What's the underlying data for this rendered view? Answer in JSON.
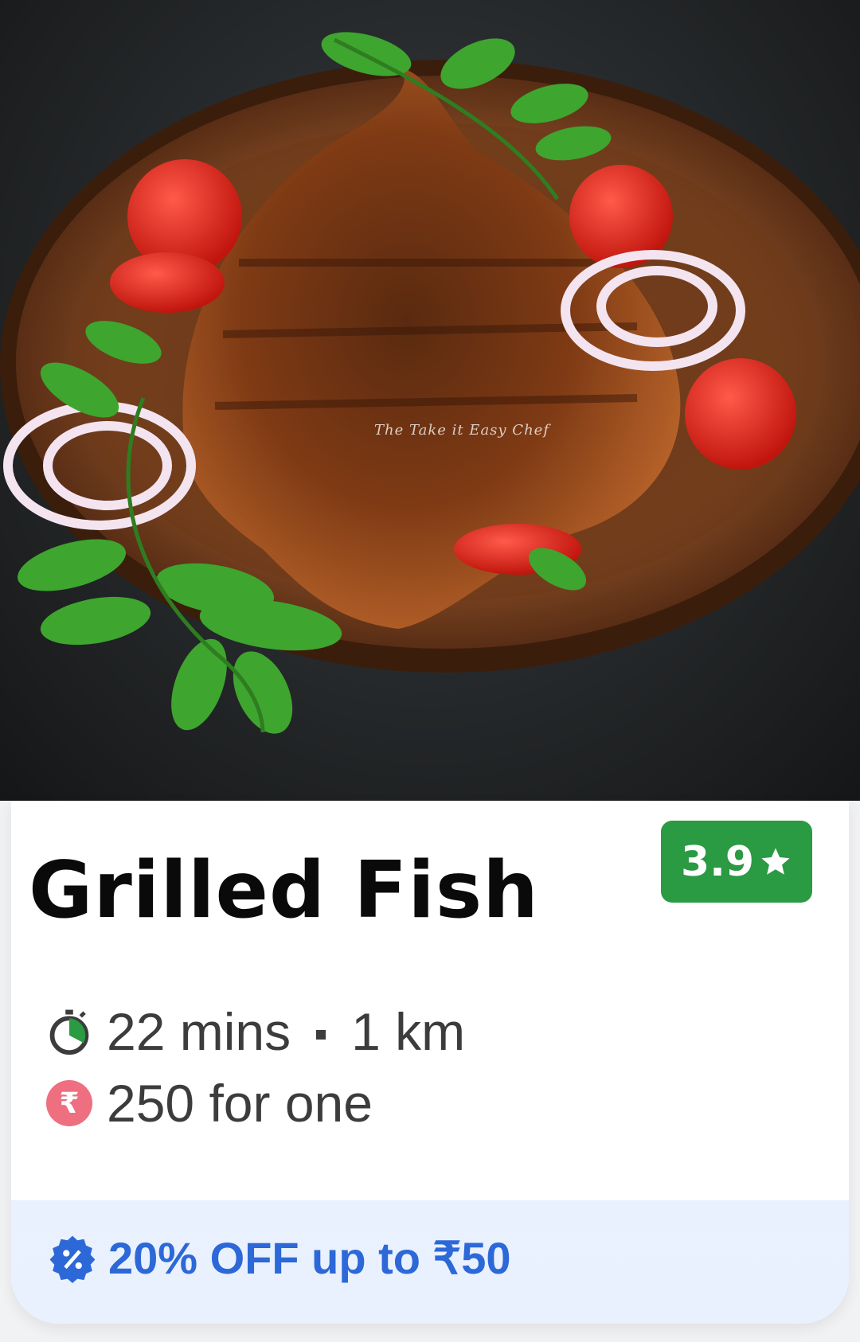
{
  "image": {
    "description_icon": "grilled-fish-photo",
    "watermark": "The Take it Easy Chef"
  },
  "dish": {
    "name": "Grilled Fish",
    "rating": "3.9",
    "rating_icon": "star-icon"
  },
  "meta": {
    "time": "22 mins",
    "distance": "1 km",
    "price": "250 for one",
    "time_icon": "stopwatch-icon",
    "price_icon": "rupee-icon",
    "rupee_symbol": "₹"
  },
  "offer": {
    "text": "20% OFF up to ₹50",
    "icon": "discount-badge-icon"
  },
  "colors": {
    "rating_bg": "#2a9a43",
    "offer_text": "#2c68d8",
    "offer_bg": "#e9f1ff",
    "rupee_badge": "#ee6f80"
  }
}
